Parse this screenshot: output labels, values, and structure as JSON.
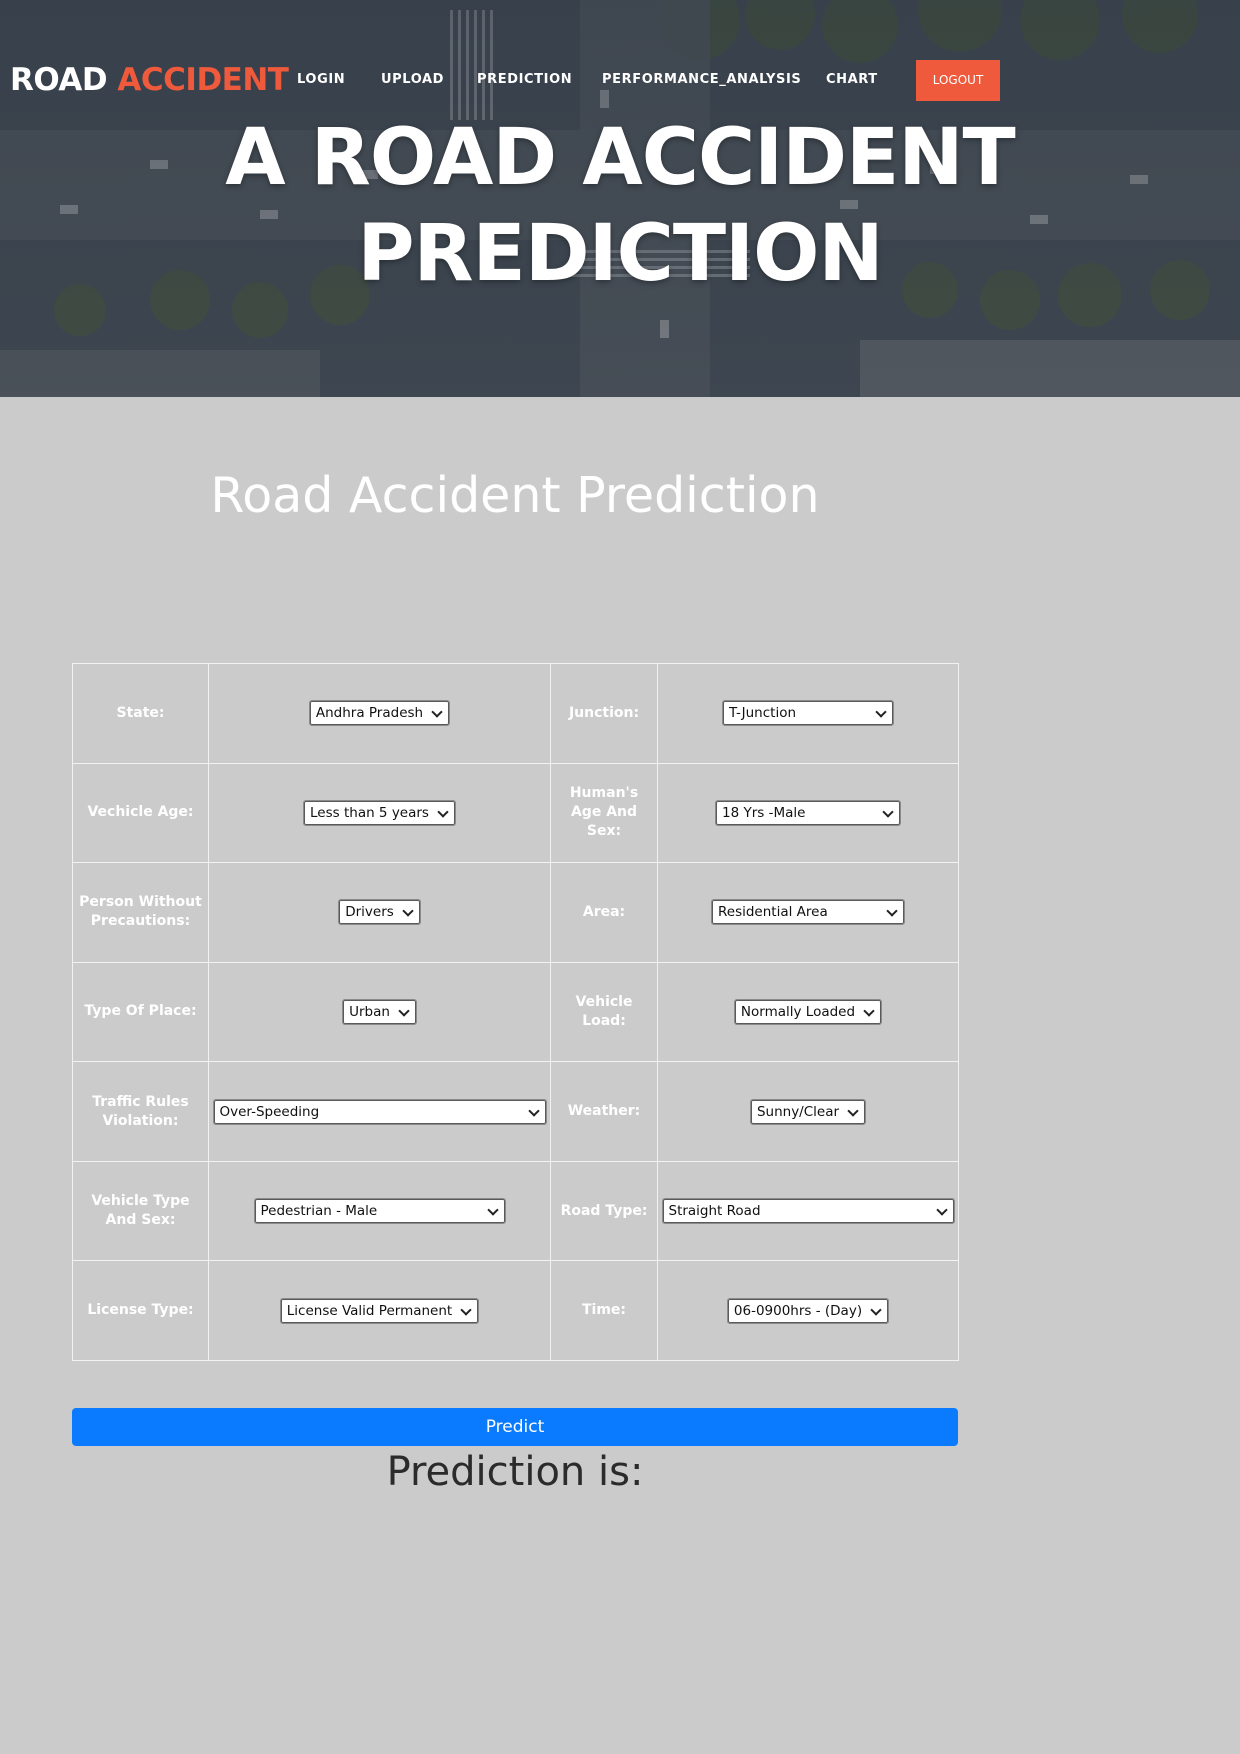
{
  "nav": {
    "brand_white": "ROAD",
    "brand_accent": "ACCIDENT",
    "links": [
      "LOGIN",
      "UPLOAD",
      "PREDICTION",
      "PERFORMANCE_ANALYSIS",
      "CHART"
    ],
    "logout": "LOGOUT"
  },
  "hero": {
    "line1": "A ROAD ACCIDENT",
    "line2": "PREDICTION"
  },
  "section_title": "Road Accident Prediction",
  "form": {
    "rows": [
      {
        "l_label": "State:",
        "l_value": "Andhra Pradesh",
        "r_label": "Junction:",
        "r_value": "T-Junction"
      },
      {
        "l_label": "Vechicle Age:",
        "l_value": "Less than 5 years",
        "r_label": "Human's Age And Sex:",
        "r_value": "18 Yrs -Male"
      },
      {
        "l_label": "Person Without Precautions:",
        "l_value": "Drivers",
        "r_label": "Area:",
        "r_value": "Residential Area"
      },
      {
        "l_label": "Type Of Place:",
        "l_value": "Urban",
        "r_label": "Vehicle Load:",
        "r_value": "Normally Loaded"
      },
      {
        "l_label": "Traffic Rules Violation:",
        "l_value": "Over-Speeding",
        "r_label": "Weather:",
        "r_value": "Sunny/Clear"
      },
      {
        "l_label": "Vehicle Type And Sex:",
        "l_value": "Pedestrian - Male",
        "r_label": "Road Type:",
        "r_value": "Straight Road"
      },
      {
        "l_label": "License Type:",
        "l_value": "License Valid Permanent",
        "r_label": "Time:",
        "r_value": "06-0900hrs - (Day)"
      }
    ]
  },
  "predict_button": "Predict",
  "result_label": "Prediction is:",
  "colors": {
    "accent": "#ef5a3d",
    "button": "#0a7bff",
    "background": "#cbcbcb"
  }
}
